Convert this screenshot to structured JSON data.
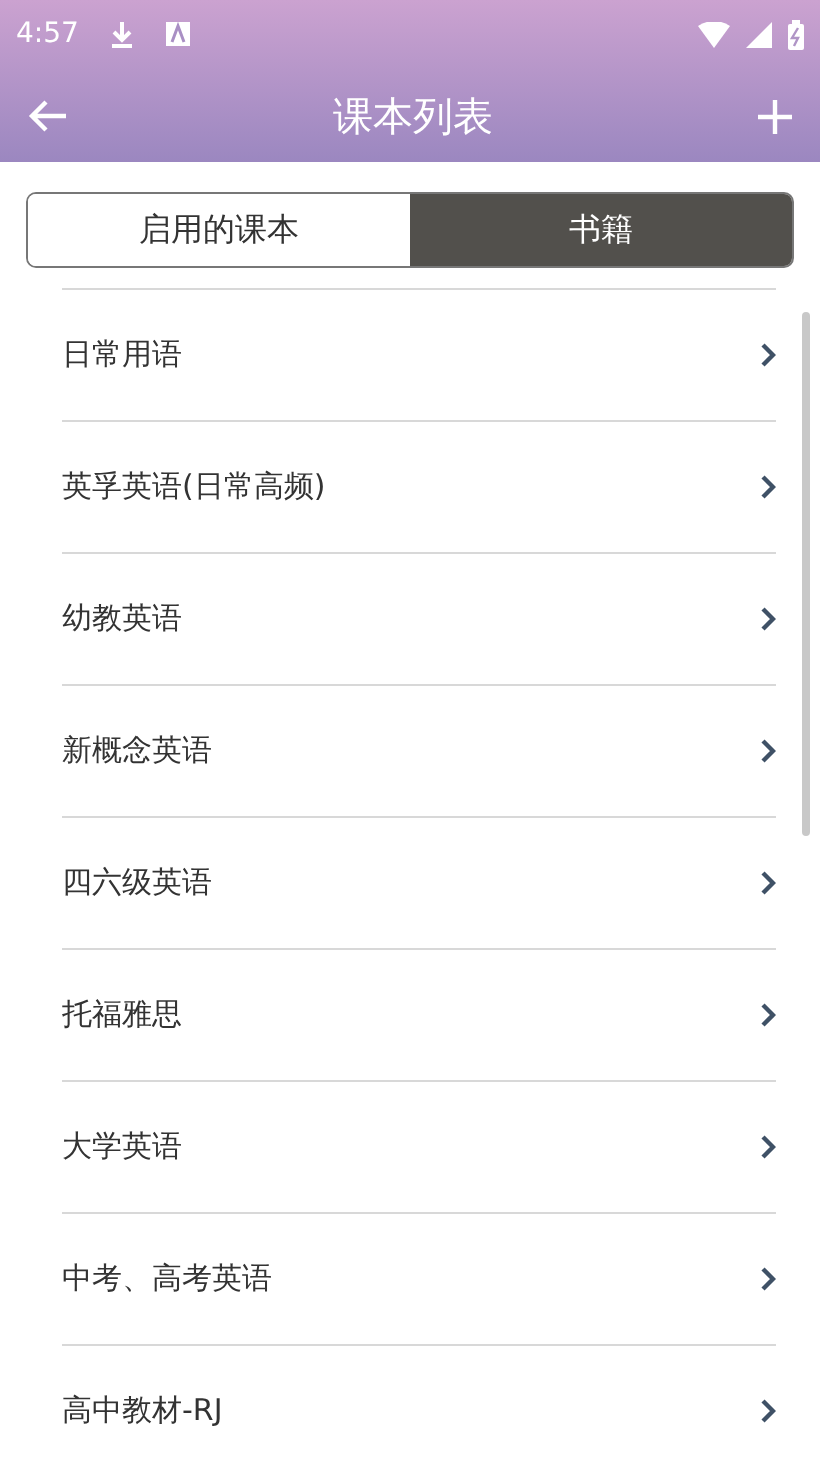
{
  "status_bar": {
    "time": "4:57"
  },
  "app_bar": {
    "title": "课本列表"
  },
  "tabs": [
    {
      "label": "启用的课本",
      "selected": false
    },
    {
      "label": "书籍",
      "selected": true
    }
  ],
  "books": [
    {
      "title": "日常用语"
    },
    {
      "title": "英孚英语(日常高频)"
    },
    {
      "title": "幼教英语"
    },
    {
      "title": "新概念英语"
    },
    {
      "title": "四六级英语"
    },
    {
      "title": "托福雅思"
    },
    {
      "title": "大学英语"
    },
    {
      "title": "中考、高考英语"
    },
    {
      "title": "高中教材-RJ"
    }
  ]
}
